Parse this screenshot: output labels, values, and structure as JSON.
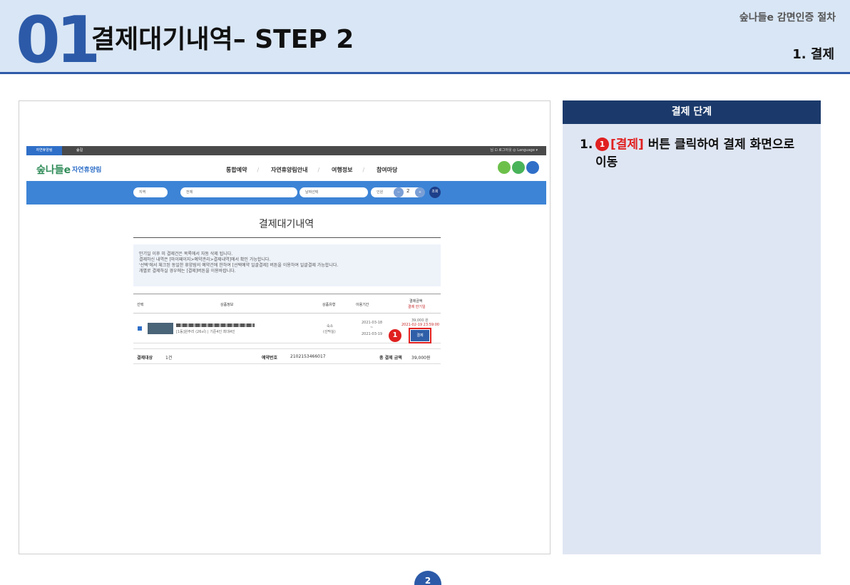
{
  "header": {
    "step_number": "01",
    "title": "결제대기내역– STEP 2",
    "right_top": "숲나들e 감면인증 절차",
    "right_sub": "1. 결제"
  },
  "site": {
    "topbar": {
      "left_tab": "자연휴양림",
      "second_tab": "숲길",
      "right_text": "님  ⊡ 로그아웃  ◎ Language ▾"
    },
    "logo_text": "숲나들e",
    "logo_sub": "자연휴양림",
    "nav_items": [
      "통합예약",
      "자연휴양림안내",
      "여행정보",
      "참여마당"
    ],
    "search": {
      "region_placeholder": "지역",
      "facility_placeholder": "전체",
      "date_placeholder": "날짜선택",
      "people_label": "인원",
      "people_count": "2",
      "search_button": "조회"
    },
    "page_heading": "결제대기내역",
    "notice_lines": [
      "만기일 이후 미 결제건은 목록에서 자동 삭제 됩니다.",
      "결제하신 내역은 [마이페이지>예약관리>결제내역]에서 확인 가능합니다.",
      "'선택'에서 체크된 동일한 휴양림의 예약건에 한하여 [선택예약 일괄결제] 버튼을 이용하여 일괄결제 가능합니다.",
      "개별로 결제하실 경우에는 [결제]버튼을 이용바랍니다."
    ],
    "table": {
      "headers": {
        "select": "선택",
        "product": "상품정보",
        "type": "상품유형",
        "period": "이용기간",
        "amount": "결제금액",
        "deadline": "결제 만기일"
      },
      "row": {
        "product_detail": "[1동]원주리 (26㎡) | 기준4인 최대4인",
        "type": "숙소",
        "type_sub": "(산막실)",
        "start_date": "2021-03-18",
        "tilde": "~",
        "end_date": "2021-03-19",
        "amount": "39,000 원",
        "deadline": "2021-02-19 23:59:00",
        "pay_button": "결제"
      }
    },
    "summary": {
      "target_label": "결제대상",
      "target_value": "1건",
      "reservation_label": "예약번호",
      "reservation_value": "2102153466017",
      "total_label": "총 결제 금액",
      "total_value": "39,000원"
    },
    "step_badge": "1"
  },
  "panel": {
    "title": "결제 단계",
    "step_no": "1.",
    "badge": "1",
    "highlight": "[결제]",
    "text_rest": " 버튼 클릭하여 결제 화면으로 이동"
  },
  "page_number": "2",
  "colors": {
    "accent": "#2c5aa8",
    "panel_head": "#1b3a6b",
    "highlight": "#e02020",
    "search_bar": "#3d84d6"
  }
}
